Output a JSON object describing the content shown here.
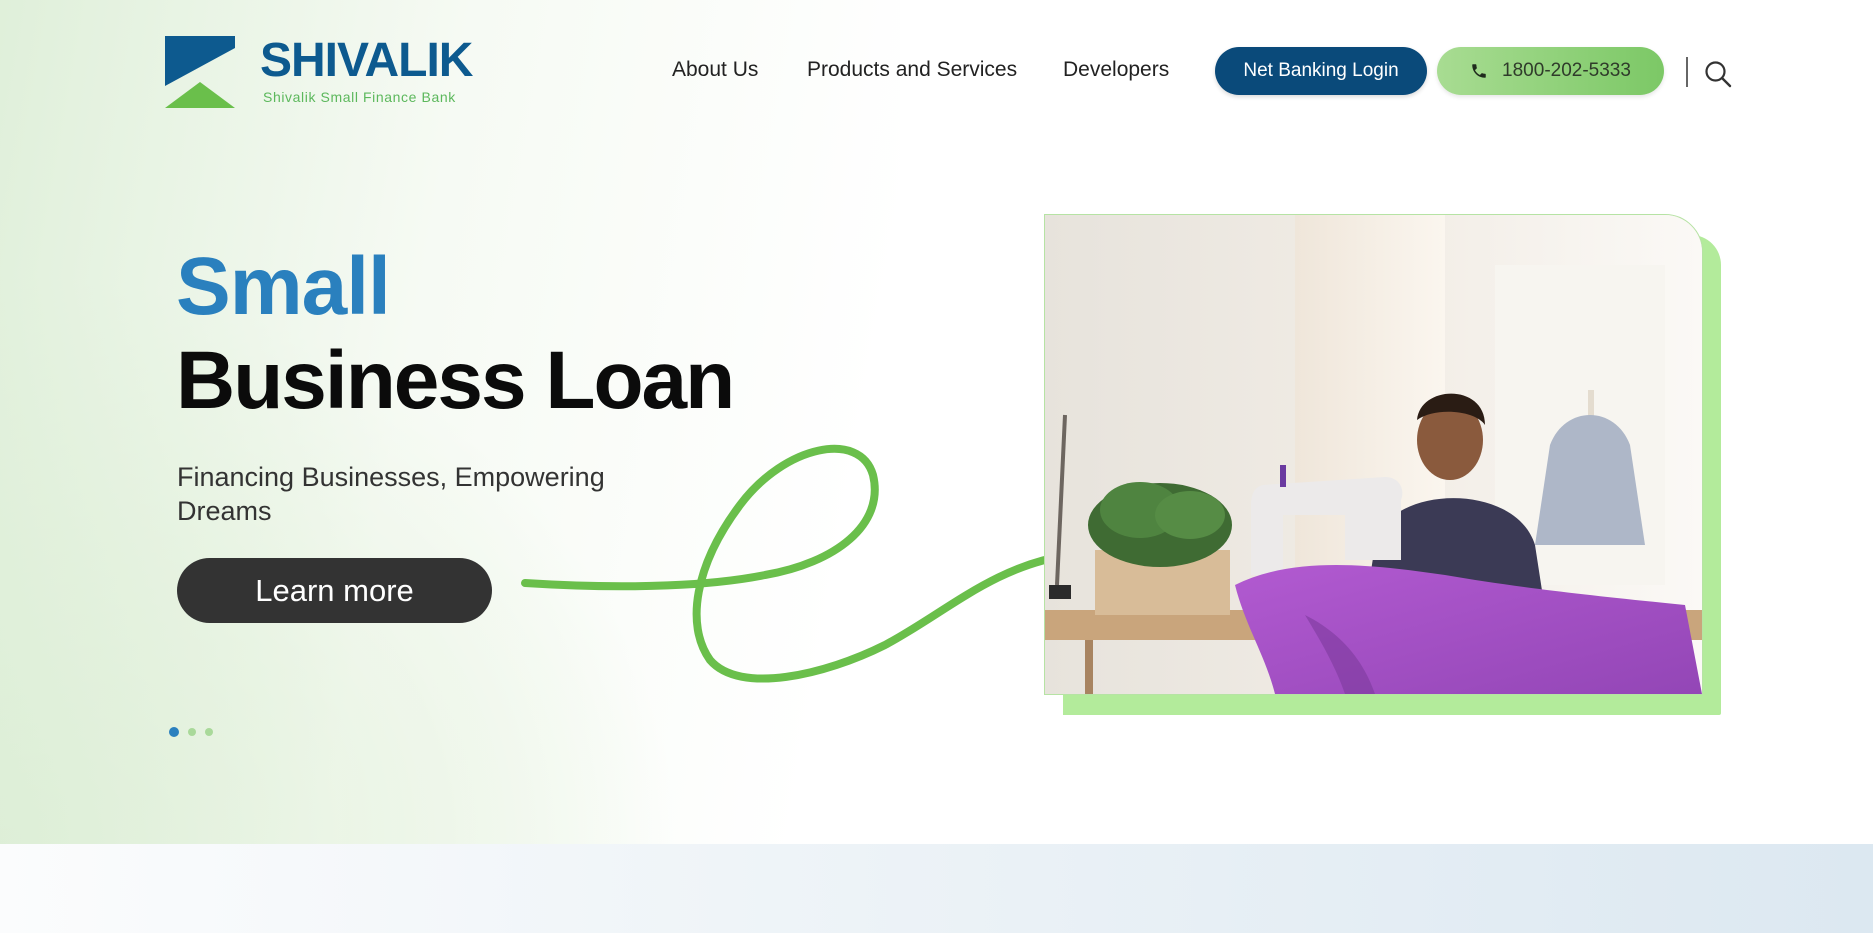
{
  "brand": {
    "name": "SHIVALIK",
    "tagline": "Shivalik Small Finance Bank",
    "primary_color": "#0d5a8f",
    "accent_color": "#5cb85c"
  },
  "nav": {
    "items": [
      "About Us",
      "Products and Services",
      "Developers"
    ],
    "login_label": "Net Banking Login",
    "phone_label": "1800-202-5333",
    "phone_icon": "phone-icon",
    "search_icon": "search-icon"
  },
  "hero": {
    "title_highlight": "Small",
    "title_main": "Business Loan",
    "subtitle": "Financing Businesses, Empowering Dreams",
    "cta_label": "Learn more",
    "slides_total": 3,
    "active_slide": 1,
    "image_description": "tailor-sewing-machine-photo"
  }
}
